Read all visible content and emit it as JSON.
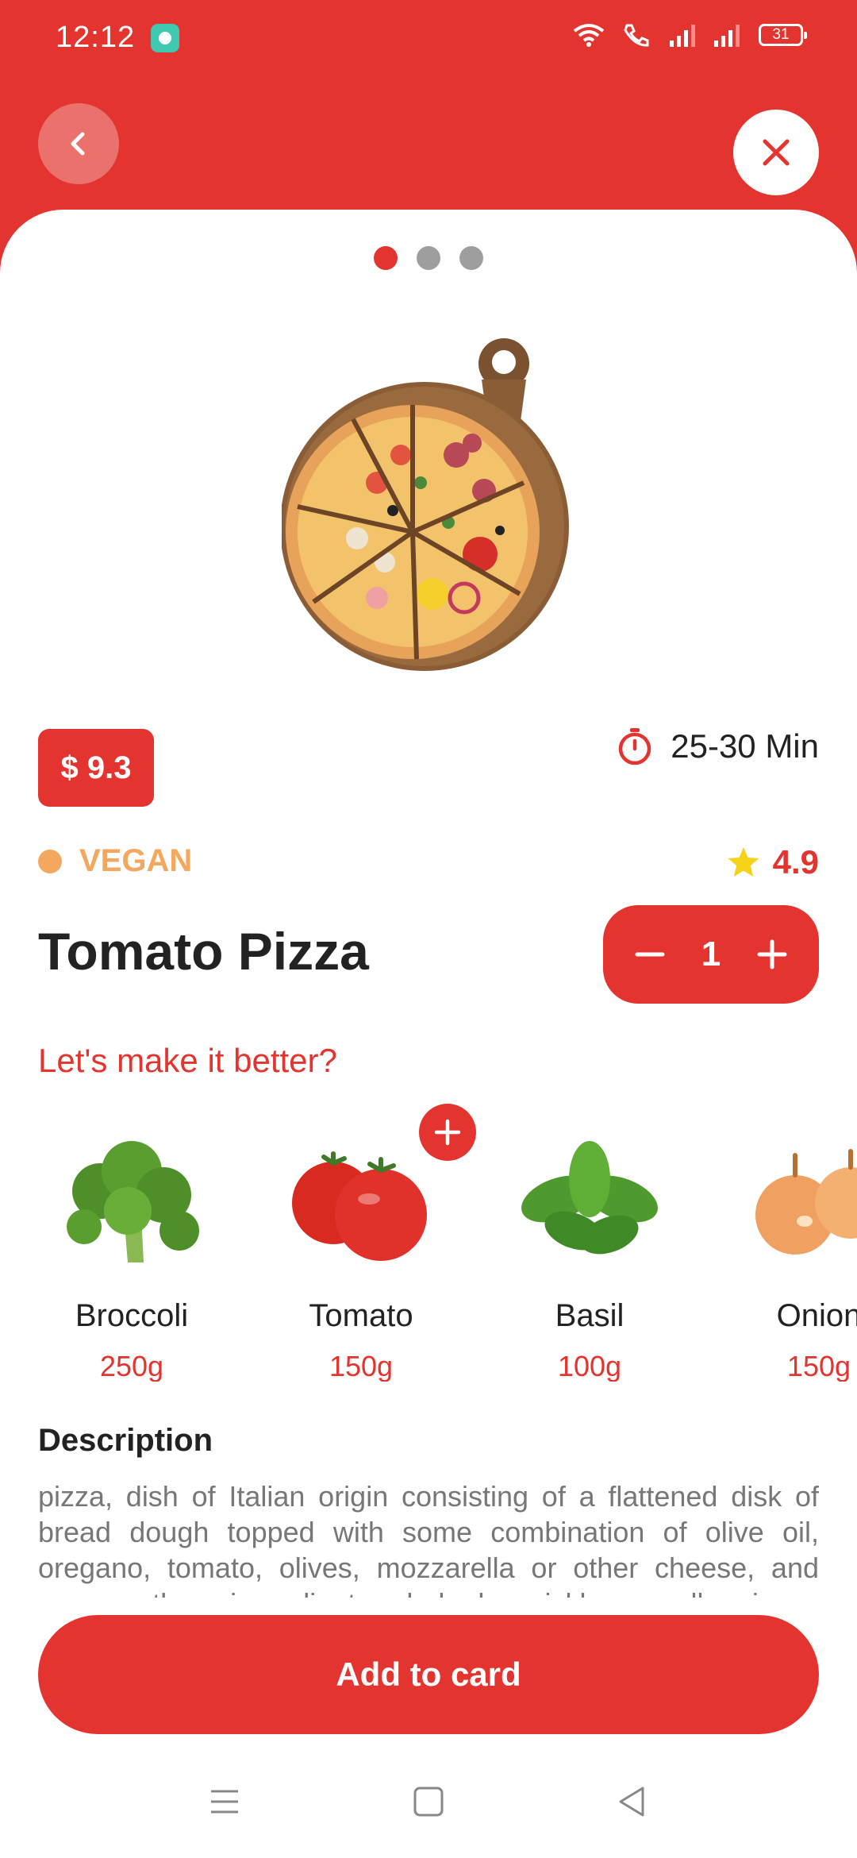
{
  "status_bar": {
    "time": "12:12",
    "battery": "31"
  },
  "carousel": {
    "count": 3,
    "active_index": 0
  },
  "product": {
    "price": "$ 9.3",
    "delivery_time": "25-30 Min",
    "tag": "VEGAN",
    "rating": "4.9",
    "name": "Tomato Pizza",
    "quantity": "1"
  },
  "ingredients_prompt": "Let's make it better?",
  "ingredients": [
    {
      "name": "Broccoli",
      "weight": "250g",
      "icon": "broccoli-image"
    },
    {
      "name": "Tomato",
      "weight": "150g",
      "icon": "tomato-image"
    },
    {
      "name": "Basil",
      "weight": "100g",
      "icon": "basil-image"
    },
    {
      "name": "Onion",
      "weight": "150g",
      "icon": "onion-image"
    }
  ],
  "description": {
    "title": "Description",
    "text": "pizza, dish of Italian origin consisting of a flattened disk of bread dough topped with some combination of olive oil, oregano, tomato, olives, mozzarella or other cheese, and many other ingredients, baked quickly—usually, in a commercial setting, using a wood-fired oven heated to a very high temperature."
  },
  "cta": {
    "label": "Add to card"
  },
  "colors": {
    "accent": "#e3342f",
    "vegan": "#f4a75e",
    "star": "#f7d21b"
  }
}
